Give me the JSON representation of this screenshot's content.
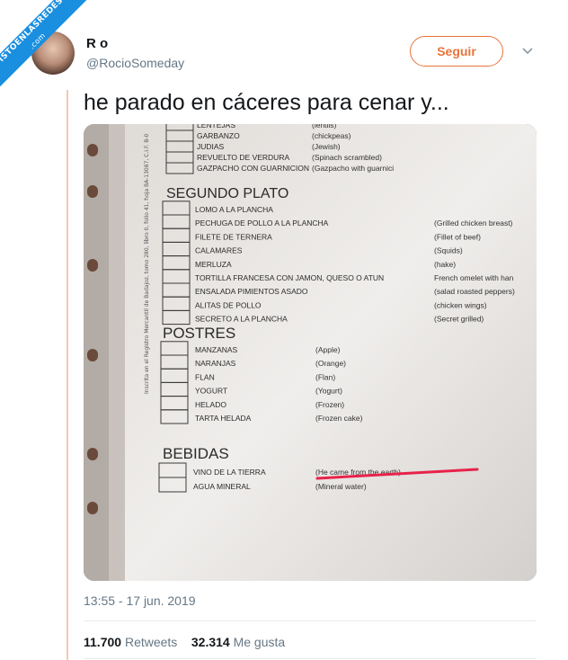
{
  "watermark": {
    "line1": "VISTOENLASREDES",
    "line2": ".com"
  },
  "user": {
    "name": "R o",
    "handle": "@RocioSomeday"
  },
  "follow_label": "Seguir",
  "tweet_text": "he parado en cáceres para cenar y...",
  "menu": {
    "top_items": [
      {
        "es": "LENTEJAS",
        "en": "(lentils)"
      },
      {
        "es": "GARBANZO",
        "en": "(chickpeas)"
      },
      {
        "es": "JUDIAS",
        "en": "(Jewish)"
      },
      {
        "es": "REVUELTO DE VERDURA",
        "en": "(Spinach scrambled)"
      },
      {
        "es": "GAZPACHO CON GUARNICION",
        "en": "(Gazpacho with guarnici"
      }
    ],
    "segundo_title": "SEGUNDO PLATO",
    "segundo_items": [
      {
        "es": "LOMO A LA PLANCHA",
        "en": ""
      },
      {
        "es": "PECHUGA DE POLLO A LA PLANCHA",
        "en": "(Grilled chicken breast)"
      },
      {
        "es": "FILETE DE TERNERA",
        "en": "(Fillet of beef)"
      },
      {
        "es": "CALAMARES",
        "en": "(Squids)"
      },
      {
        "es": "MERLUZA",
        "en": "(hake)"
      },
      {
        "es": "TORTILLA FRANCESA CON JAMON, QUESO O ATUN",
        "en": "French omelet with han"
      },
      {
        "es": "ENSALADA PIMIENTOS ASADO",
        "en": "(salad roasted peppers)"
      },
      {
        "es": "ALITAS DE POLLO",
        "en": "(chicken wings)"
      },
      {
        "es": "SECRETO A LA PLANCHA",
        "en": "(Secret grilled)"
      }
    ],
    "postres_title": "POSTRES",
    "postres_items": [
      {
        "es": "MANZANAS",
        "en": "(Apple)"
      },
      {
        "es": "NARANJAS",
        "en": "(Orange)"
      },
      {
        "es": "FLAN",
        "en": "(Flan)"
      },
      {
        "es": "YOGURT",
        "en": "(Yogurt)"
      },
      {
        "es": "HELADO",
        "en": "(Frozen)"
      },
      {
        "es": "TARTA HELADA",
        "en": "(Frozen cake)"
      }
    ],
    "bebidas_title": "BEBIDAS",
    "bebidas_items": [
      {
        "es": "VINO DE LA TIERRA",
        "en": "(He came from the earth)"
      },
      {
        "es": "AGUA MINERAL",
        "en": "(Mineral water)"
      }
    ],
    "side_text": "Inscrita en el Registro Mercantil de Badajoz, tomo 280, libro 0, folio 41, hoja BA-13087, C.I.F. B-0"
  },
  "timestamp": "13:55 - 17 jun. 2019",
  "retweets_count": "11.700",
  "retweets_label": "Retweets",
  "likes_count": "32.314",
  "likes_label": "Me gusta",
  "colors": {
    "accent": "#e8743b",
    "watermark": "#1a8fe0",
    "underline": "#e8234a"
  }
}
